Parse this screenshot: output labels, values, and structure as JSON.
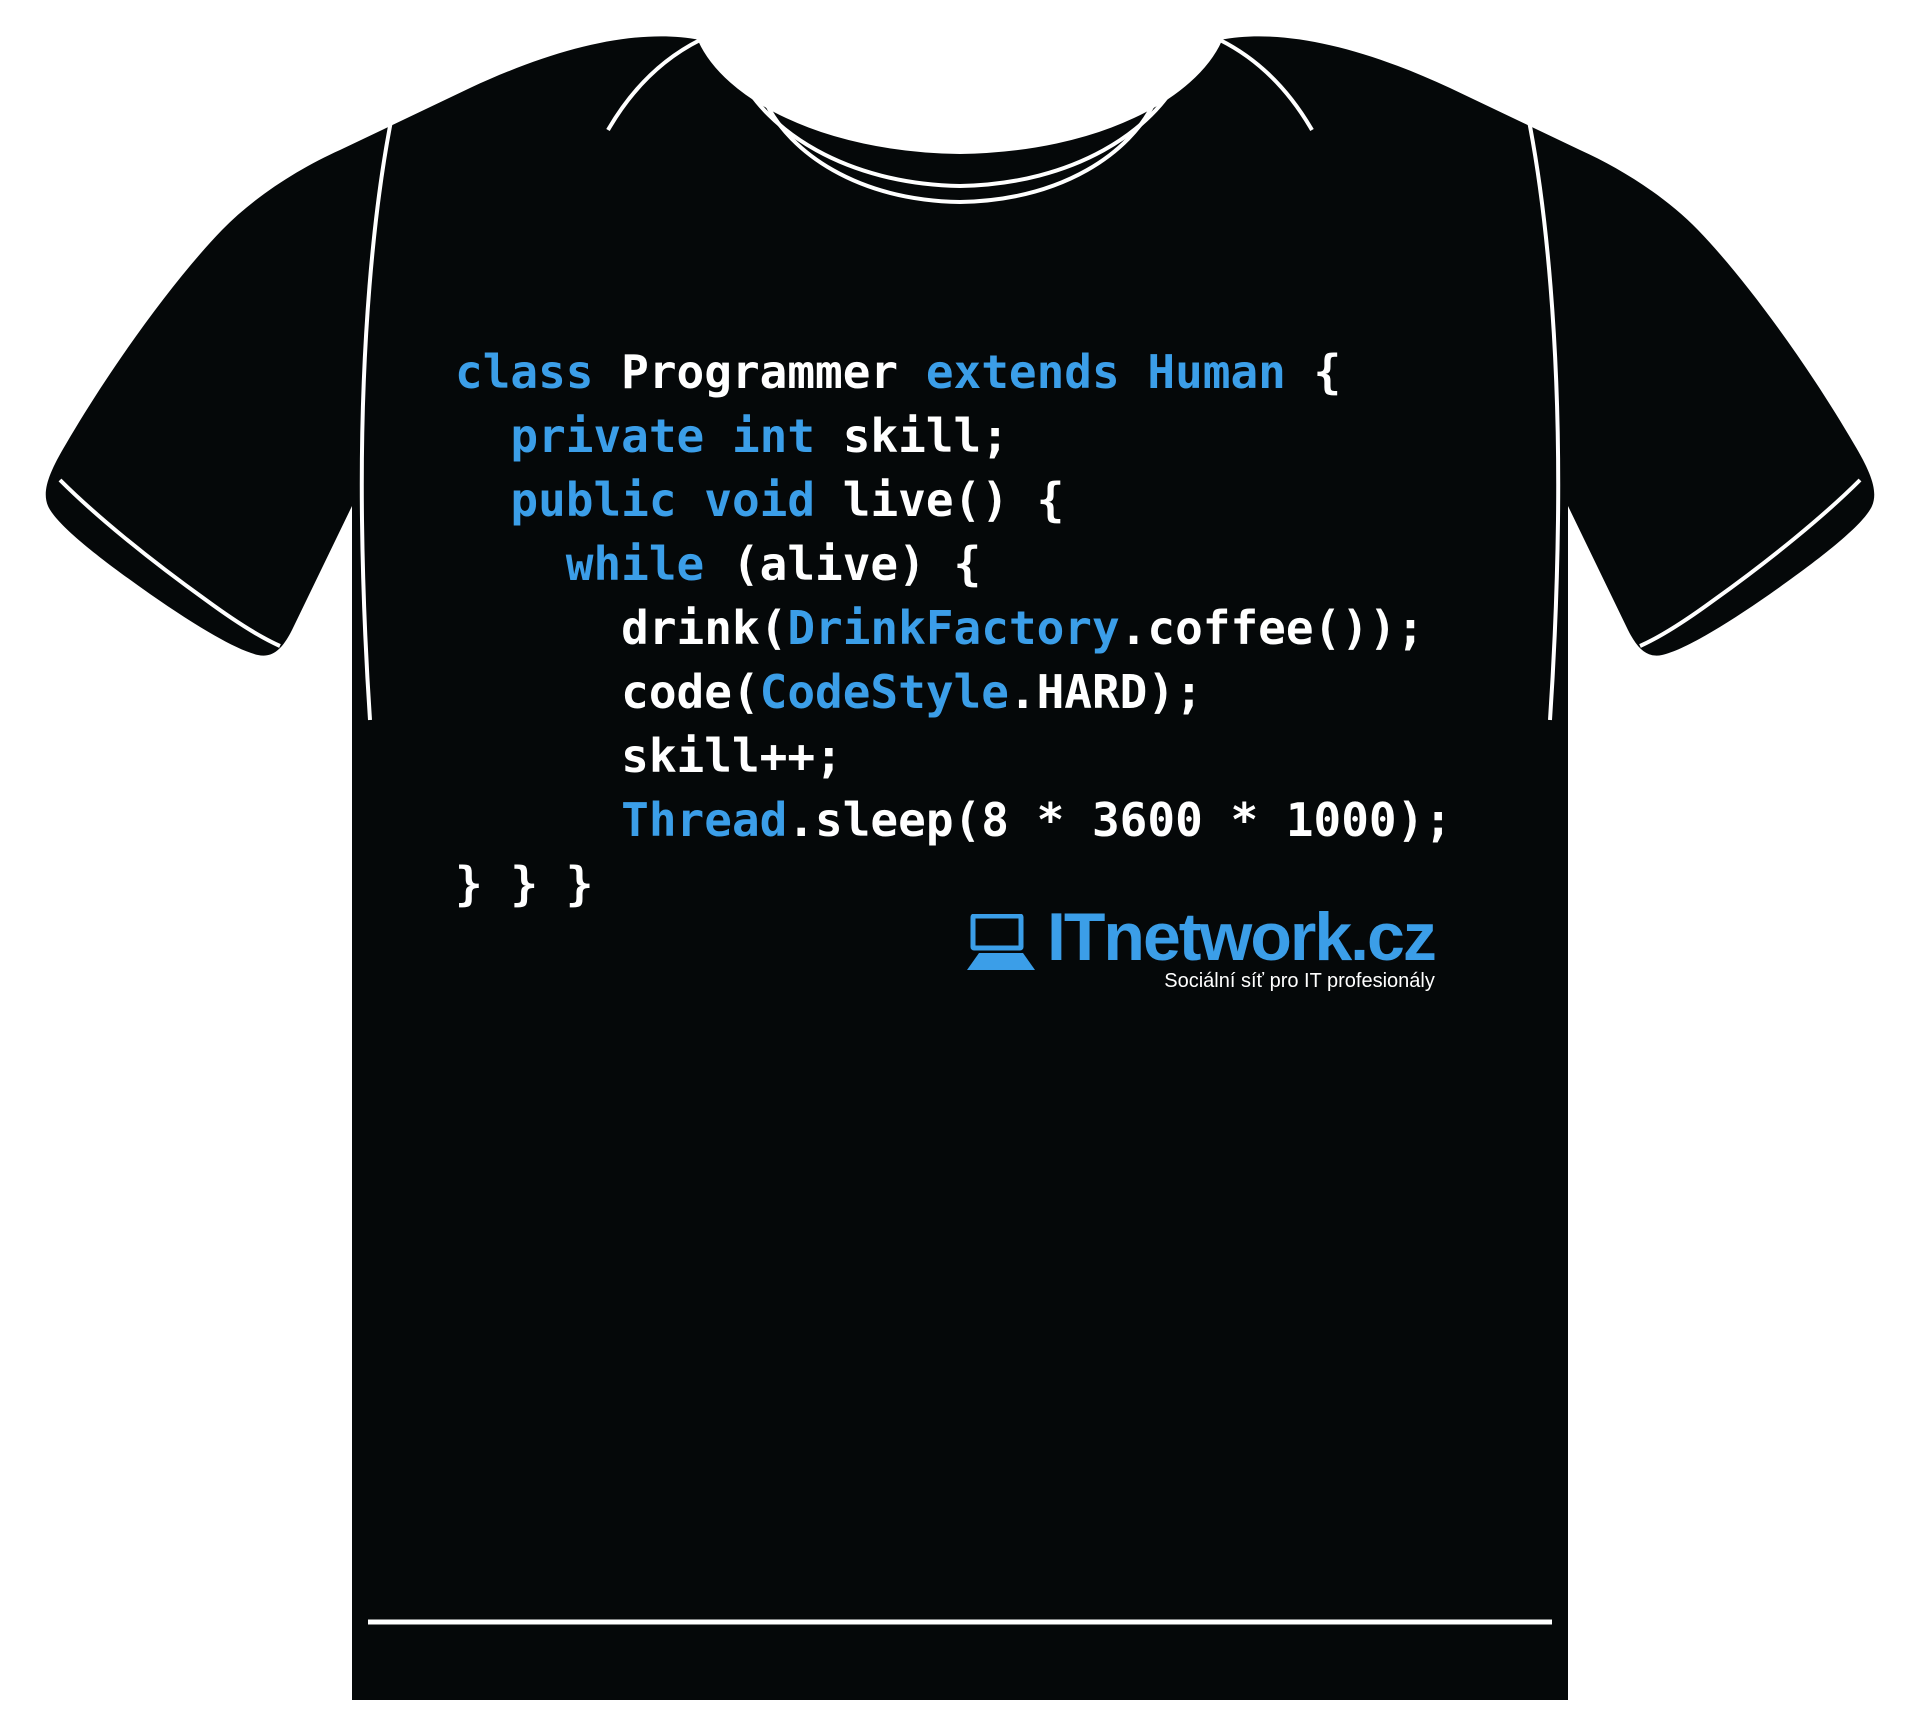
{
  "artwork": {
    "title": "Programmer t-shirt front print",
    "garment": "black t-shirt",
    "colors": {
      "shirt": "#050809",
      "stitch": "#ffffff",
      "background": "#ffffff",
      "code_keyword": "#3b9ee8",
      "code_plain": "#ffffff",
      "brand_blue": "#3b9ee8"
    }
  },
  "code_print": {
    "language": "java",
    "lines": [
      {
        "indent": 0,
        "tokens": [
          {
            "t": "class ",
            "c": "kw"
          },
          {
            "t": "Programmer ",
            "c": "pl"
          },
          {
            "t": "extends ",
            "c": "kw"
          },
          {
            "t": "Human ",
            "c": "cls"
          },
          {
            "t": "{",
            "c": "pl"
          }
        ]
      },
      {
        "indent": 1,
        "tokens": [
          {
            "t": "private ",
            "c": "kw"
          },
          {
            "t": "int ",
            "c": "kw"
          },
          {
            "t": "skill;",
            "c": "pl"
          }
        ]
      },
      {
        "indent": 1,
        "tokens": [
          {
            "t": "public ",
            "c": "kw"
          },
          {
            "t": "void ",
            "c": "kw"
          },
          {
            "t": "live() {",
            "c": "pl"
          }
        ]
      },
      {
        "indent": 2,
        "tokens": [
          {
            "t": "while ",
            "c": "kw"
          },
          {
            "t": "(alive) {",
            "c": "pl"
          }
        ]
      },
      {
        "indent": 3,
        "tokens": [
          {
            "t": "drink(",
            "c": "pl"
          },
          {
            "t": "DrinkFactory",
            "c": "cls"
          },
          {
            "t": ".coffee());",
            "c": "pl"
          }
        ]
      },
      {
        "indent": 3,
        "tokens": [
          {
            "t": "code(",
            "c": "pl"
          },
          {
            "t": "CodeStyle",
            "c": "cls"
          },
          {
            "t": ".HARD);",
            "c": "pl"
          }
        ]
      },
      {
        "indent": 3,
        "tokens": [
          {
            "t": "skill++;",
            "c": "pl"
          }
        ]
      },
      {
        "indent": 3,
        "tokens": [
          {
            "t": "Thread",
            "c": "cls"
          },
          {
            "t": ".sleep(8 * 3600 * 1000);",
            "c": "pl"
          }
        ]
      },
      {
        "indent": 0,
        "tokens": [
          {
            "t": "} } }",
            "c": "pl"
          }
        ]
      }
    ],
    "plain_text": "class Programmer extends Human {\n  private int skill;\n  public void live() {\n    while (alive) {\n      drink(DrinkFactory.coffee());\n      code(CodeStyle.HARD);\n      skill++;\n      Thread.sleep(8 * 3600 * 1000);\n} } }"
  },
  "logo": {
    "icon": "laptop-icon",
    "wordmark": "ITnetwork.cz",
    "tagline": "Sociální síť pro IT profesionály"
  }
}
